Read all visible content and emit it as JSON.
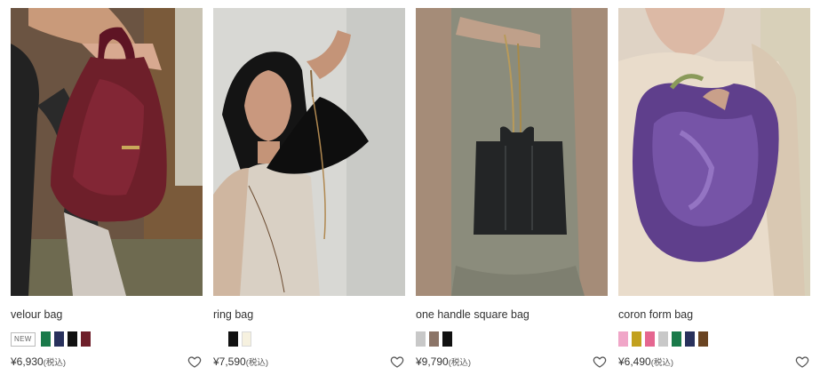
{
  "products": [
    {
      "name": "velour bag",
      "badge": "NEW",
      "colors": [
        "#1a7a4a",
        "#28315c",
        "#111111",
        "#6e1f2a"
      ],
      "price": "¥6,930",
      "tax": "(税込)",
      "image": "maroon-velour-bag-photo"
    },
    {
      "name": "ring bag",
      "badge": "",
      "colors": [
        "#111111",
        "#f6f1df"
      ],
      "price": "¥7,590",
      "tax": "(税込)",
      "image": "black-ring-bag-photo"
    },
    {
      "name": "one handle square bag",
      "badge": "",
      "colors": [
        "#c8c8c8",
        "#8b7467",
        "#111111"
      ],
      "price": "¥9,790",
      "tax": "(税込)",
      "image": "black-square-bag-photo"
    },
    {
      "name": "coron form bag",
      "badge": "",
      "colors": [
        "#f0a6c8",
        "#c2a11f",
        "#e56690",
        "#c8c8c8",
        "#1a7a4a",
        "#28315c",
        "#6a4422"
      ],
      "price": "¥6,490",
      "tax": "(税込)",
      "image": "purple-satin-bag-photo"
    }
  ],
  "icons": {
    "favorite": "heart-outline-icon"
  }
}
